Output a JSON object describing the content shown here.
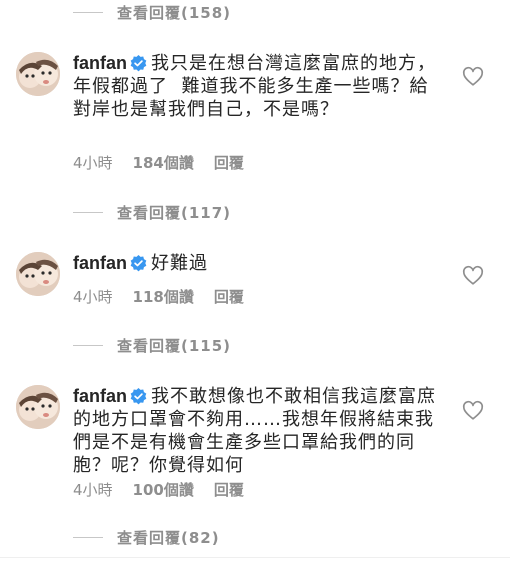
{
  "comments": [
    {
      "username": "fanfan",
      "text": "我只是在想台灣這麼富庶的地方，\n年假都過了  難道我不能多生產一些嗎？給對岸也是幫我們自己，不是嗎？",
      "time": "4小時",
      "likes": "184個讚",
      "reply_label": "回覆",
      "view_replies": "查看回覆(117)"
    },
    {
      "username": "fanfan",
      "text": "好難過",
      "time": "4小時",
      "likes": "118個讚",
      "reply_label": "回覆",
      "view_replies": "查看回覆(115)"
    },
    {
      "username": "fanfan",
      "text": "我不敢想像也不敢相信我這麼富庶的地方口罩會不夠用……我想年假將結束我們是不是有機會生產多些口罩給我們的同胞？呢？你覺得如何",
      "time": "4小時",
      "likes": "100個讚",
      "reply_label": "回覆",
      "view_replies": "查看回覆(82)"
    }
  ],
  "top_view_replies": "查看回覆(158)",
  "icons": {
    "verified": "verified-badge-icon",
    "like": "heart-outline-icon",
    "avatar": "avatar-photo"
  },
  "colors": {
    "verified_blue": "#3897f0",
    "text": "#262626",
    "secondary": "#8e8e8e"
  }
}
